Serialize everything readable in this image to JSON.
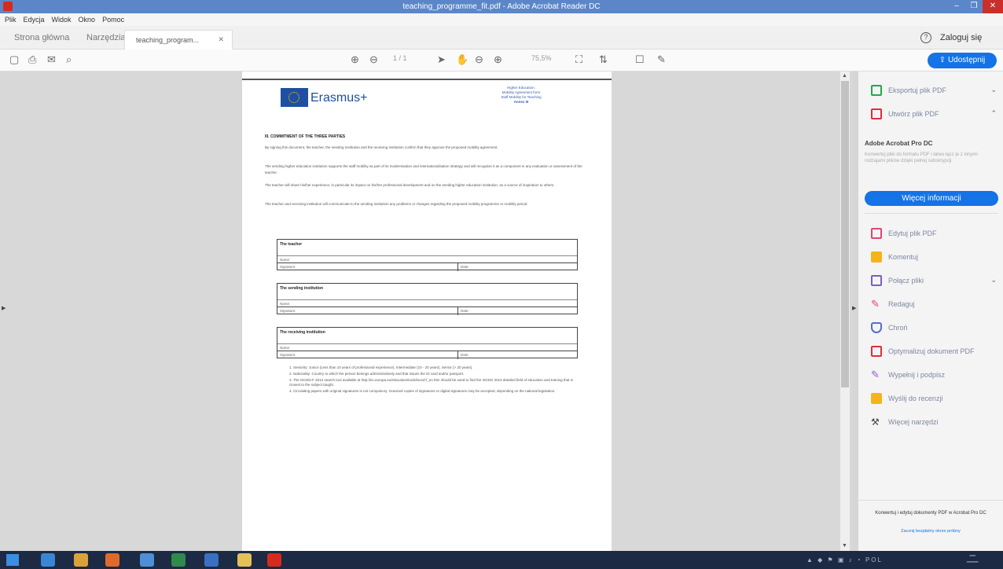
{
  "window": {
    "title": "teaching_programme_fit.pdf - Adobe Acrobat Reader DC"
  },
  "menu": [
    "Plik",
    "Edycja",
    "Widok",
    "Okno",
    "Pomoc"
  ],
  "tabs": {
    "home": "Strona główna",
    "tools": "Narzędzia",
    "document": "teaching_program..."
  },
  "signin": "Zaloguj się",
  "toolbar": {
    "page": "1 / 1",
    "zoom": "75,5%",
    "share": "Udostępnij"
  },
  "document": {
    "logo_text": "Erasmus+",
    "header_right": [
      "Higher Education:",
      "Mobility Agreement form",
      "Staff Mobility for Teaching",
      "Annex III"
    ],
    "section_title": "III. COMMITMENT OF THE THREE PARTIES",
    "paragraphs": [
      "By signing this document, the teacher, the sending institution and the receiving institution confirm that they approve the proposed mobility agreement.",
      "The sending higher education institution supports the staff mobility as part of its modernisation and internationalisation strategy and will recognise it as a component in any evaluation or assessment of the teacher.",
      "The teacher will share his/her experience, in particular its impact on his/her professional development and on the sending higher education institution, as a source of inspiration to others.",
      "The teacher and receiving institution will communicate to the sending institution any problems or changes regarding the proposed mobility programme or mobility period."
    ],
    "boxes": [
      {
        "label": "The teacher",
        "name": "Name:",
        "signature": "Signature:",
        "date": "Date:"
      },
      {
        "label": "The sending institution",
        "name": "Name:",
        "signature": "Signature:",
        "date": "Date:"
      },
      {
        "label": "The receiving institution",
        "name": "Name:",
        "signature": "Signature:",
        "date": "Date:"
      }
    ],
    "footnotes": [
      "1. Seniority: Junior (Less than 10 years of professional experience), Intermediate (10 - 20 years), Senior (> 20 years).",
      "2. Nationality: Country to which the person belongs administratively and that issues the ID card and/or passport.",
      "3. The ISCED-F 2013 search tool available at http://ec.europa.eu/education/tools/isced-f_en.htm should be used to find the ISCED 2013 detailed field of education and training that is closest to the subject taught.",
      "4. Circulating papers with original signatures is not compulsory. Scanned copies of signatures or digital signatures may be accepted, depending on the national legislation."
    ]
  },
  "rightpane": {
    "tools_top": [
      {
        "label": "Eksportuj plik PDF",
        "icon": "export-pdf-icon",
        "color": "#27a745",
        "chevron": "⌄"
      },
      {
        "label": "Utwórz plik PDF",
        "icon": "create-pdf-icon",
        "color": "#e02d3c",
        "chevron": "⌃"
      }
    ],
    "pro": {
      "title": "Adobe Acrobat Pro DC",
      "desc": "Konwertuj pliki do formatu PDF i łatwo łącz je z innymi rodzajami plików dzięki pełnej subskrypcji.",
      "button": "Więcej informacji"
    },
    "tools": [
      {
        "label": "Edytuj plik PDF",
        "icon": "edit-pdf-icon",
        "color": "#e0457b",
        "chevron": ""
      },
      {
        "label": "Komentuj",
        "icon": "comment-icon",
        "color": "#f3b51a",
        "chevron": ""
      },
      {
        "label": "Połącz pliki",
        "icon": "combine-files-icon",
        "color": "#7b5ec6",
        "chevron": "⌄"
      },
      {
        "label": "Redaguj",
        "icon": "redact-icon",
        "color": "#e0457b",
        "chevron": ""
      },
      {
        "label": "Chroń",
        "icon": "protect-icon",
        "color": "#5b6ad0",
        "chevron": ""
      },
      {
        "label": "Optymalizuj dokument PDF",
        "icon": "optimize-pdf-icon",
        "color": "#e02d3c",
        "chevron": ""
      },
      {
        "label": "Wypełnij i podpisz",
        "icon": "fill-sign-icon",
        "color": "#8e5ed6",
        "chevron": ""
      },
      {
        "label": "Wyślij do recenzji",
        "icon": "send-review-icon",
        "color": "#f3b51a",
        "chevron": ""
      },
      {
        "label": "Więcej narzędzi",
        "icon": "more-tools-icon",
        "color": "#444444",
        "chevron": ""
      }
    ],
    "promo_text": "Konwertuj i edytuj dokumenty PDF w Acrobat Pro DC",
    "promo_link": "Zacznij bezpłatny okres próbny"
  },
  "taskbar": {
    "apps": [
      {
        "name": "ie-icon",
        "color": "#3a86d4"
      },
      {
        "name": "chrome-icon",
        "color": "#d9a33a"
      },
      {
        "name": "firefox-icon",
        "color": "#e06a2b"
      },
      {
        "name": "app-icon",
        "color": "#4d8fd6"
      },
      {
        "name": "excel-icon",
        "color": "#2f8a4c"
      },
      {
        "name": "word-icon",
        "color": "#3a6fc2"
      },
      {
        "name": "explorer-icon",
        "color": "#e3c05a"
      },
      {
        "name": "acrobat-icon",
        "color": "#d52b1e"
      }
    ],
    "lang": "POL"
  }
}
